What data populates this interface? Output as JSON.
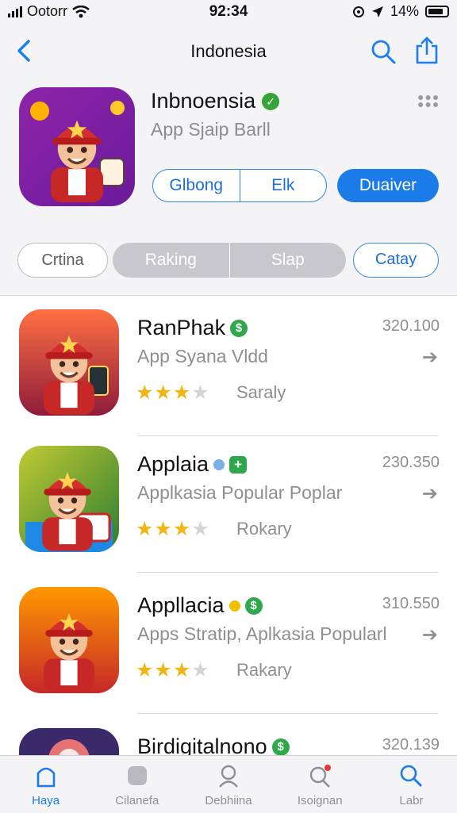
{
  "status_bar": {
    "carrier": "Ootorr",
    "time": "92:34",
    "battery": "14%"
  },
  "nav": {
    "title": "Indonesia"
  },
  "hero": {
    "name": "Inbnoensia",
    "subtitle": "App Sjaip Barll"
  },
  "segmented": {
    "option_1": "Glbong",
    "option_2": "Elk",
    "primary": "Duaiver"
  },
  "filters": {
    "left": "Crtina",
    "mid_1": "Raking",
    "mid_2": "Slap",
    "right": "Catay"
  },
  "apps": [
    {
      "name": "RanPhak",
      "subtitle": "App Syana Vldd",
      "count": "320.100",
      "rating_label": "Saraly",
      "stars": 3.5
    },
    {
      "name": "Applaia",
      "subtitle": "Applkasia Popular Poplar",
      "count": "230.350",
      "rating_label": "Rokary",
      "stars": 3.5
    },
    {
      "name": "Appllacia",
      "subtitle": "Apps Stratip, Aplkasia Popularl",
      "count": "310.550",
      "rating_label": "Rakary",
      "stars": 3
    },
    {
      "name": "Birdigitalnono",
      "count": "320.139"
    }
  ],
  "tabs": [
    {
      "label": "Haya",
      "icon": "home-icon",
      "active": true
    },
    {
      "label": "Cilanefa",
      "icon": "apps-icon",
      "active": false
    },
    {
      "label": "Debhiina",
      "icon": "person-icon",
      "active": false
    },
    {
      "label": "Isoignan",
      "icon": "search-alert-icon",
      "active": false
    },
    {
      "label": "Labr",
      "icon": "search-icon",
      "active": false
    }
  ],
  "colors": {
    "accent": "#1b7be8",
    "star": "#f2b614",
    "verified": "#36a33b"
  }
}
